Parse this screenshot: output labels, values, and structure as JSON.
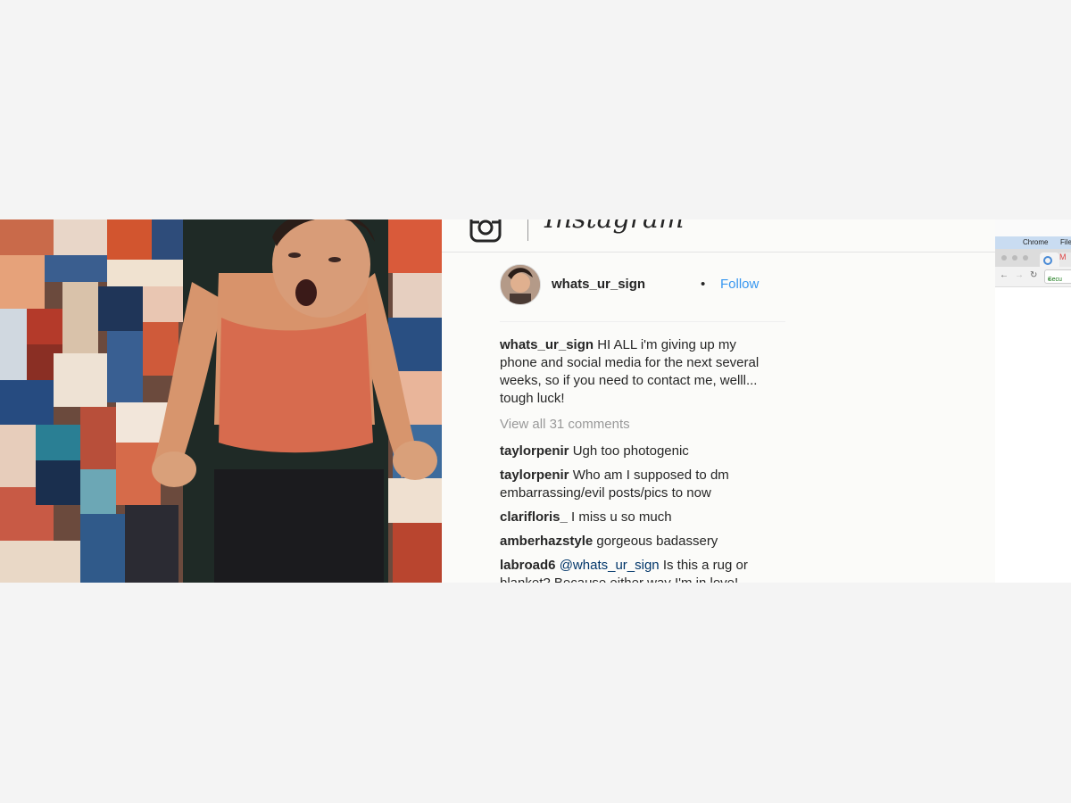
{
  "instagram": {
    "wordmark": "Instagram",
    "logo_icon": "instagram-camera-icon",
    "post": {
      "username": "whats_ur_sign",
      "separator": "•",
      "follow_label": "Follow",
      "caption_user": "whats_ur_sign",
      "caption_text": " HI ALL i'm giving up my phone and social media for the next several weeks, so if you need to contact me, welll... tough luck!",
      "view_all": "View all 31 comments",
      "comments": [
        {
          "user": "taylorpenir",
          "text": " Ugh too photogenic"
        },
        {
          "user": "taylorpenir",
          "text": " Who am I supposed to dm embarrassing/evil posts/pics to now"
        },
        {
          "user": "clarifloris_",
          "text": " I miss u so much"
        },
        {
          "user": "amberhazstyle",
          "text": " gorgeous badassery"
        },
        {
          "user": "labroad6",
          "mention": " @whats_ur_sign",
          "text": " Is this a rug or blanket? Because either way I'm in love!"
        }
      ]
    }
  },
  "chrome": {
    "menu_app": "Chrome",
    "menu_file": "File",
    "tab2_letter": "M",
    "address": "Secu",
    "icons": [
      "apple-icon",
      "back-arrow-icon",
      "forward-arrow-icon",
      "reload-icon",
      "lock-icon"
    ]
  },
  "colors": {
    "follow": "#3897f0",
    "text": "#262626",
    "muted": "#999999",
    "mention": "#003569"
  }
}
